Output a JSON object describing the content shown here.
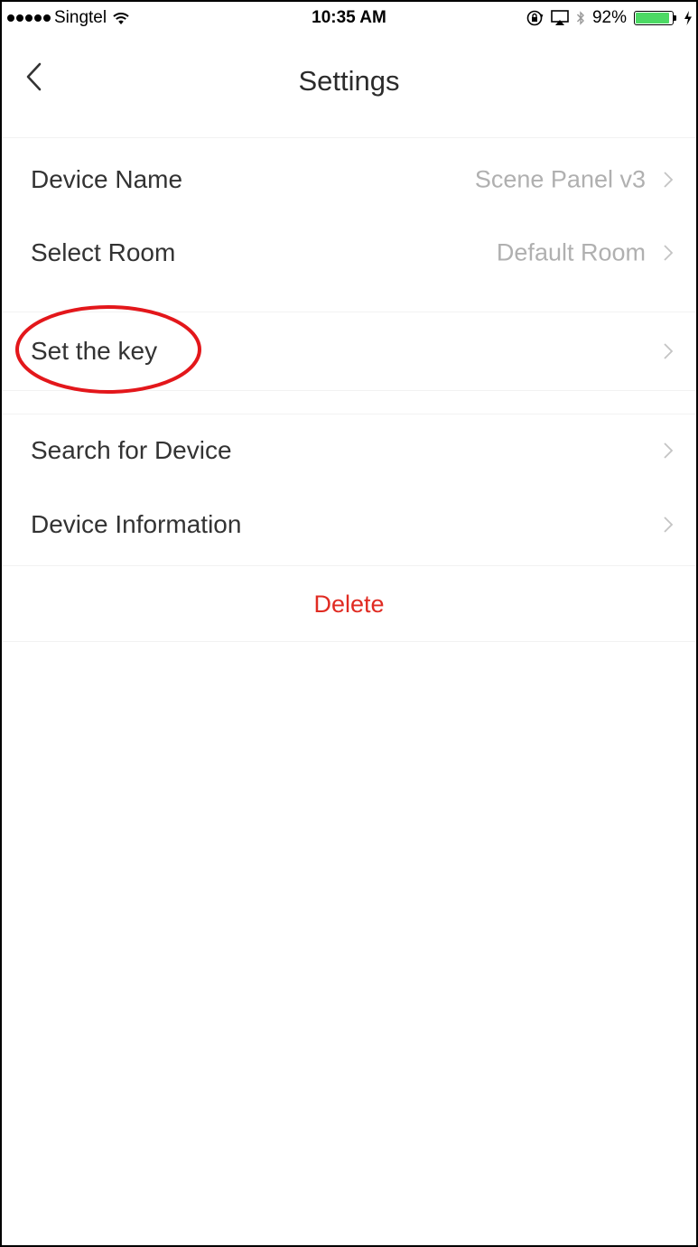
{
  "status_bar": {
    "carrier": "Singtel",
    "time": "10:35 AM",
    "battery_percent_text": "92%",
    "battery_level": 0.92,
    "battery_color": "#4cd964",
    "icons": [
      "signal-dots",
      "wifi-icon",
      "orientation-lock-icon",
      "airplay-icon",
      "bluetooth-icon",
      "battery-icon",
      "charging-bolt-icon"
    ]
  },
  "nav": {
    "title": "Settings",
    "back_icon": "chevron-left-icon"
  },
  "settings": {
    "device_name": {
      "label": "Device Name",
      "value": "Scene Panel v3"
    },
    "select_room": {
      "label": "Select Room",
      "value": "Default Room"
    },
    "set_key": {
      "label": "Set the key"
    },
    "search_device": {
      "label": "Search for Device"
    },
    "device_info": {
      "label": "Device Information"
    }
  },
  "delete_label": "Delete",
  "colors": {
    "delete": "#e02b22",
    "highlight_ring": "#e3171b",
    "secondary_text": "#b0b0b0"
  }
}
